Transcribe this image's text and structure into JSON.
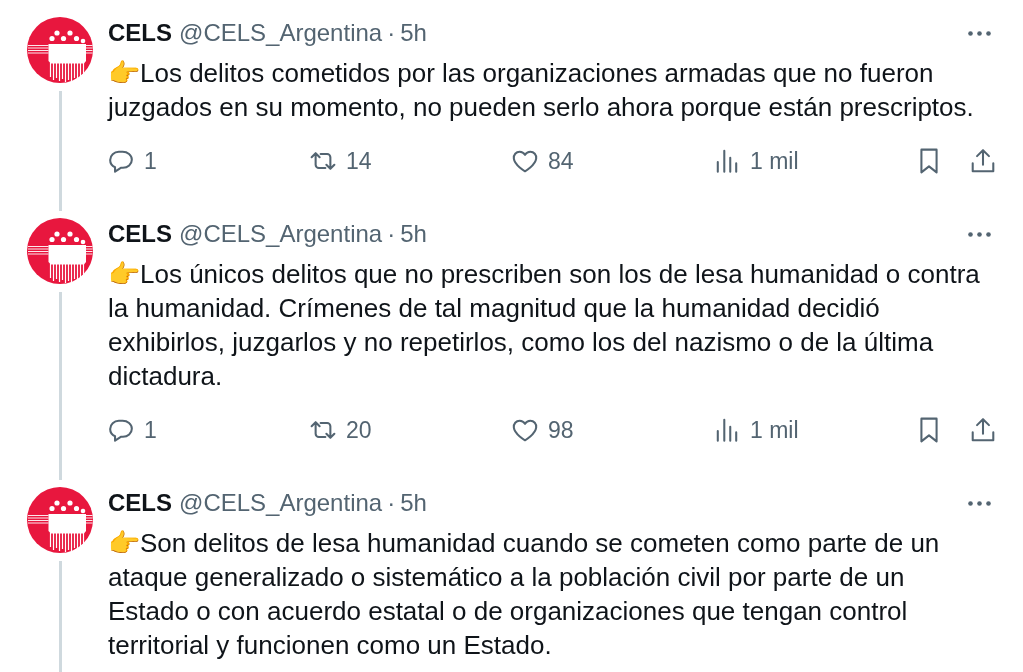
{
  "tweets": [
    {
      "author": {
        "name": "CELS",
        "handle": "@CELS_Argentina",
        "separator": "·",
        "time": "5h"
      },
      "text": "👉Los delitos cometidos por las organizaciones armadas que no fueron juzgados en su momento, no pueden serlo ahora porque están prescriptos.",
      "actions": [
        {
          "kind": "reply",
          "count": "1"
        },
        {
          "kind": "repost",
          "count": "14"
        },
        {
          "kind": "like",
          "count": "84"
        },
        {
          "kind": "views",
          "count": "1 mil"
        },
        {
          "kind": "bookmark"
        },
        {
          "kind": "share"
        }
      ]
    },
    {
      "author": {
        "name": "CELS",
        "handle": "@CELS_Argentina",
        "separator": "·",
        "time": "5h"
      },
      "text": "👉Los únicos delitos que no prescriben son los de lesa humanidad o contra la humanidad. Crímenes de tal magnitud que la humanidad decidió exhibirlos, juzgarlos y no repetirlos, como los del nazismo o de la última dictadura.",
      "actions": [
        {
          "kind": "reply",
          "count": "1"
        },
        {
          "kind": "repost",
          "count": "20"
        },
        {
          "kind": "like",
          "count": "98"
        },
        {
          "kind": "views",
          "count": "1 mil"
        },
        {
          "kind": "bookmark"
        },
        {
          "kind": "share"
        }
      ]
    },
    {
      "author": {
        "name": "CELS",
        "handle": "@CELS_Argentina",
        "separator": "·",
        "time": "5h"
      },
      "text": "👉Son delitos de lesa humanidad cuando se cometen como parte de un ataque generalizado o sistemático a la población civil por parte de un Estado o con acuerdo estatal o de organizaciones que tengan control territorial y funcionen como un Estado."
    }
  ]
}
